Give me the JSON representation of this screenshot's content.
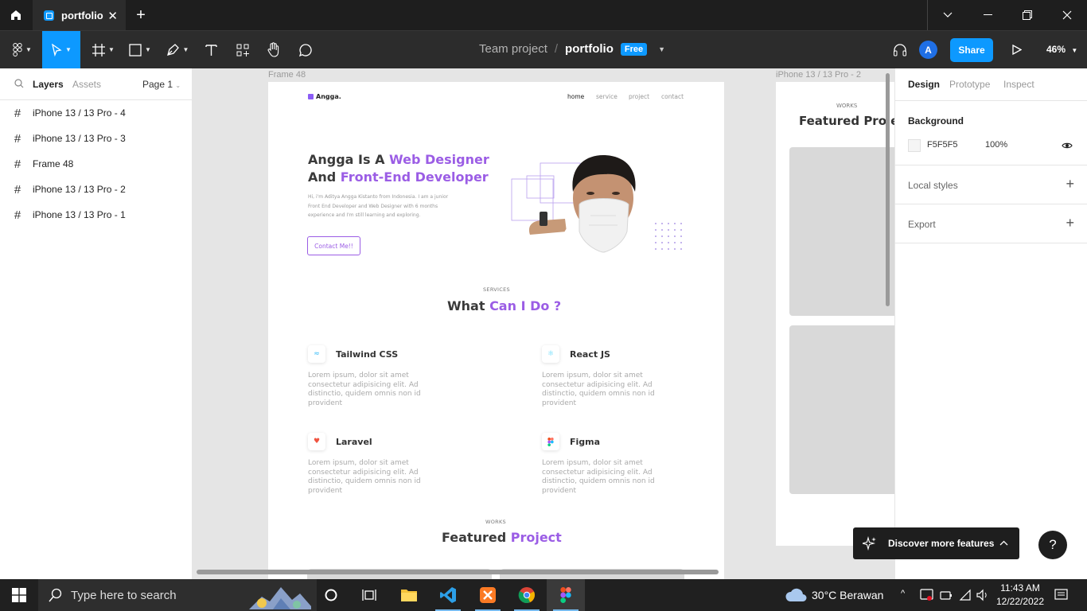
{
  "titlebar": {
    "tab_title": "portfolio",
    "tab_close": "✕",
    "new_tab": "+",
    "minimize": "—",
    "maximize": "❐",
    "close": "✕",
    "dropdown": "⌄"
  },
  "toolbar": {
    "team": "Team project",
    "slash": "/",
    "file": "portfolio",
    "plan_badge": "Free",
    "share_label": "Share",
    "avatar_initial": "A",
    "zoom": "46%",
    "accent": "#0d99ff"
  },
  "left_panel": {
    "tab_layers": "Layers",
    "tab_assets": "Assets",
    "page_selector": "Page 1",
    "layers": [
      "iPhone 13 / 13 Pro - 4",
      "iPhone 13 / 13 Pro - 3",
      "Frame 48",
      "iPhone 13 / 13 Pro - 2",
      "iPhone 13 / 13 Pro - 1"
    ]
  },
  "canvas": {
    "frame_label": "Frame 48",
    "frame2_label": "iPhone 13 / 13 Pro - 2",
    "site": {
      "logo": "Angga.",
      "nav": [
        "home",
        "service",
        "project",
        "contact"
      ],
      "hero_line1_a": "Angga Is A ",
      "hero_line1_b": "Web Designer",
      "hero_line2_a": "And ",
      "hero_line2_b": "Front-End Developer",
      "hero_paragraph": "Hi, i'm Aditya Angga Kistanto from Indonesia. I am a junior Front End Developer and Web Designer with 6 months experience and I'm still learning and exploring.",
      "contact_button": "Contact Me!!",
      "services_kicker": "SERVICES",
      "services_title_a": "What ",
      "services_title_b": "Can I Do ?",
      "services": [
        {
          "title": "Tailwind CSS",
          "desc": "Lorem ipsum, dolor sit amet consectetur adipisicing elit. Ad distinctio, quidem omnis non id provident",
          "icon": "tailwind-icon"
        },
        {
          "title": "React JS",
          "desc": "Lorem ipsum, dolor sit amet consectetur adipisicing elit. Ad distinctio, quidem omnis non id provident",
          "icon": "react-icon"
        },
        {
          "title": "Laravel",
          "desc": "Lorem ipsum, dolor sit amet consectetur adipisicing elit. Ad distinctio, quidem omnis non id provident",
          "icon": "laravel-icon"
        },
        {
          "title": "Figma",
          "desc": "Lorem ipsum, dolor sit amet consectetur adipisicing elit. Ad distinctio, quidem omnis non id provident",
          "icon": "figma-icon"
        }
      ],
      "works_kicker": "WORKS",
      "works_title_a": "Featured ",
      "works_title_b": "Project",
      "accent": "#9b5de5"
    },
    "frame2": {
      "works_kicker": "WORKS",
      "works_title": "Featured Project"
    }
  },
  "right_panel": {
    "tab_design": "Design",
    "tab_prototype": "Prototype",
    "tab_inspect": "Inspect",
    "background_heading": "Background",
    "bg_color": "F5F5F5",
    "bg_opacity": "100%",
    "local_styles": "Local styles",
    "export": "Export",
    "plus": "+"
  },
  "discover": {
    "label": "Discover more features",
    "chevron": "^"
  },
  "help": "?",
  "taskbar": {
    "search_placeholder": "Type here to search",
    "weather": "30°C  Berawan",
    "time": "11:43 AM",
    "date": "12/22/2022"
  }
}
